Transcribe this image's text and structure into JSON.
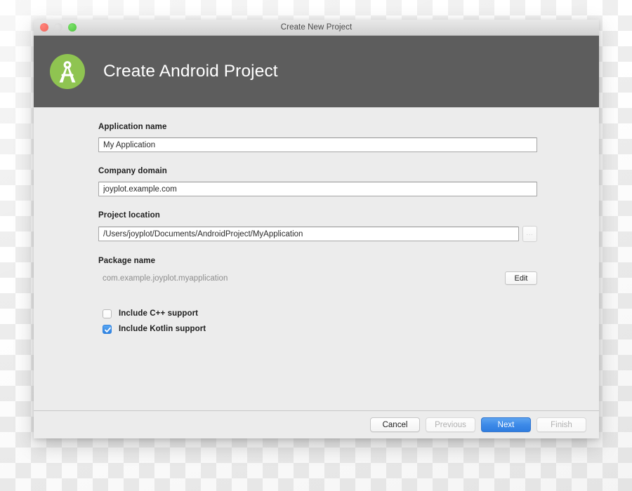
{
  "window": {
    "title": "Create New Project",
    "traffic_lights": [
      "close-button",
      "minimize-button",
      "zoom-button"
    ]
  },
  "header": {
    "title": "Create Android Project",
    "logo_icon": "android-studio-logo-icon",
    "background_color": "#5d5d5d"
  },
  "form": {
    "application_name": {
      "label": "Application name",
      "value": "My Application"
    },
    "company_domain": {
      "label": "Company domain",
      "value": "joyplot.example.com"
    },
    "project_location": {
      "label": "Project location",
      "value": "/Users/joyplot/Documents/AndroidProject/MyApplication",
      "browse_label": "..."
    },
    "package_name": {
      "label": "Package name",
      "value": "com.example.joyplot.myapplication",
      "edit_label": "Edit"
    },
    "options": [
      {
        "label": "Include C++ support",
        "checked": false
      },
      {
        "label": "Include Kotlin support",
        "checked": true
      }
    ]
  },
  "footer": {
    "cancel": "Cancel",
    "previous": "Previous",
    "next": "Next",
    "finish": "Finish",
    "accent_color": "#3d8ae8"
  }
}
